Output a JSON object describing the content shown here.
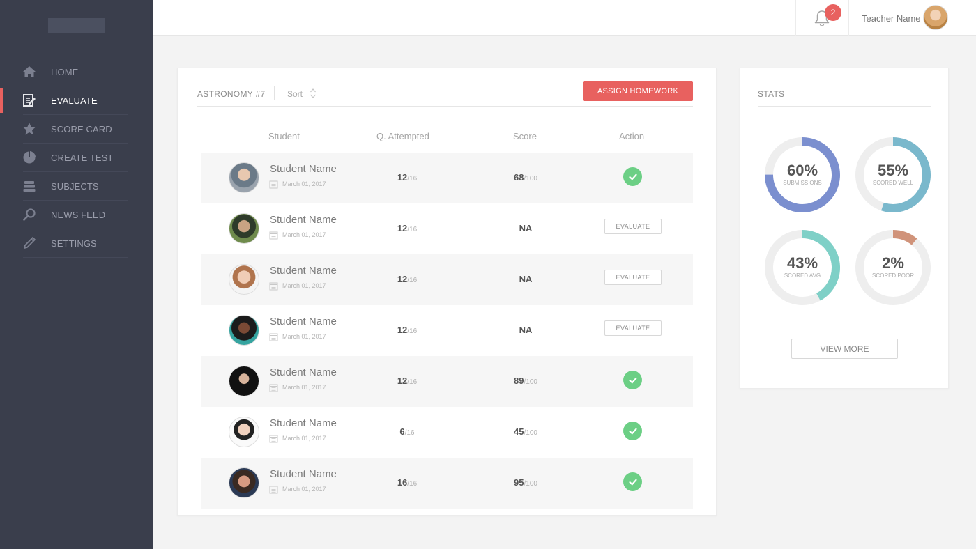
{
  "sidebar": {
    "items": [
      {
        "label": "HOME",
        "icon": "home-icon"
      },
      {
        "label": "EVALUATE",
        "icon": "edit-icon",
        "active": true
      },
      {
        "label": "SCORE CARD",
        "icon": "star-icon"
      },
      {
        "label": "CREATE TEST",
        "icon": "pie-icon"
      },
      {
        "label": "SUBJECTS",
        "icon": "stack-icon"
      },
      {
        "label": "NEWS FEED",
        "icon": "search-icon"
      },
      {
        "label": "SETTINGS",
        "icon": "pencil-icon"
      }
    ]
  },
  "topbar": {
    "notification_count": "2",
    "teacher_name": "Teacher Name"
  },
  "main": {
    "course_title": "ASTRONOMY #7",
    "sort_label": "Sort",
    "assign_button": "ASSIGN HOMEWORK",
    "columns": {
      "student": "Student",
      "attempted": "Q. Attempted",
      "score": "Score",
      "action": "Action"
    },
    "rows": [
      {
        "name": "Student Name",
        "date": "March 01, 2017",
        "attempted": "12",
        "attempted_total": "/16",
        "score": "68",
        "score_total": "/100",
        "action": "check"
      },
      {
        "name": "Student Name",
        "date": "March 01, 2017",
        "attempted": "12",
        "attempted_total": "/16",
        "score": "NA",
        "score_total": "",
        "action": "EVALUATE"
      },
      {
        "name": "Student Name",
        "date": "March 01, 2017",
        "attempted": "12",
        "attempted_total": "/16",
        "score": "NA",
        "score_total": "",
        "action": "EVALUATE"
      },
      {
        "name": "Student Name",
        "date": "March 01, 2017",
        "attempted": "12",
        "attempted_total": "/16",
        "score": "NA",
        "score_total": "",
        "action": "EVALUATE"
      },
      {
        "name": "Student Name",
        "date": "March 01, 2017",
        "attempted": "12",
        "attempted_total": "/16",
        "score": "89",
        "score_total": "/100",
        "action": "check"
      },
      {
        "name": "Student Name",
        "date": "March 01, 2017",
        "attempted": "6",
        "attempted_total": "/16",
        "score": "45",
        "score_total": "/100",
        "action": "check"
      },
      {
        "name": "Student Name",
        "date": "March 01, 2017",
        "attempted": "16",
        "attempted_total": "/16",
        "score": "95",
        "score_total": "/100",
        "action": "check"
      }
    ]
  },
  "stats": {
    "title": "STATS",
    "donuts": [
      {
        "value": "60%",
        "label": "SUBMISSIONS",
        "fraction": 0.75,
        "color": "#7b8fcf"
      },
      {
        "value": "55%",
        "label": "SCORED WELL",
        "fraction": 0.55,
        "color": "#7ab8cc"
      },
      {
        "value": "43%",
        "label": "SCORED AVG",
        "fraction": 0.42,
        "color": "#7fd0c7"
      },
      {
        "value": "2%",
        "label": "SCORED POOR",
        "fraction": 0.11,
        "color": "#d0937a"
      }
    ],
    "view_more": "VIEW MORE"
  },
  "colors": {
    "accent": "#e8615f",
    "sidebar": "#3a3e4c",
    "success": "#6ccf85"
  }
}
